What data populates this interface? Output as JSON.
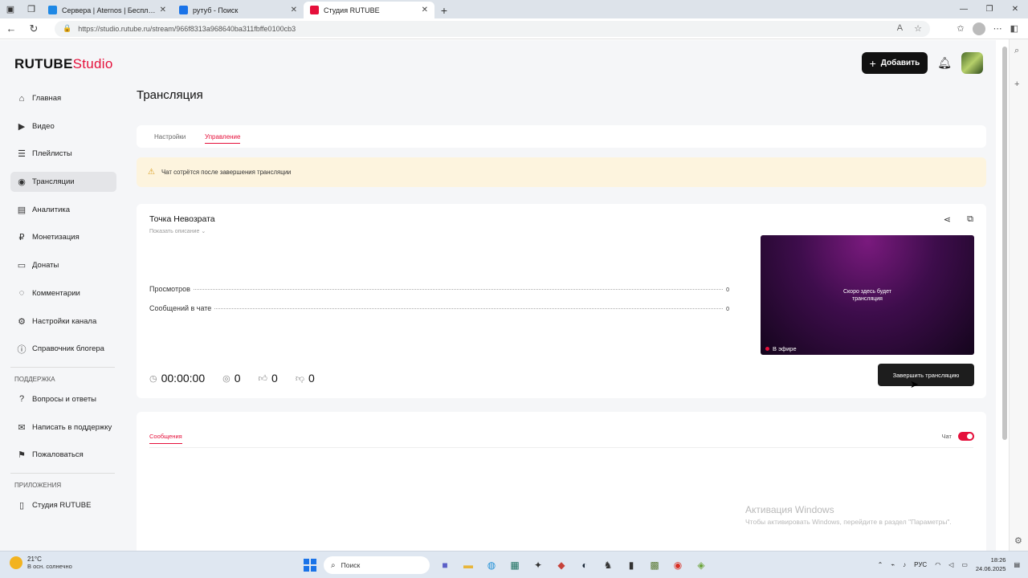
{
  "browser": {
    "tabs": [
      {
        "title": "Сервера | Aternos | Бесплатный",
        "active": false,
        "color": "#1e88e5"
      },
      {
        "title": "рутуб - Поиск",
        "active": false,
        "color": "#1a73e8"
      },
      {
        "title": "Студия RUTUBE",
        "active": true,
        "color": "#e5103b"
      }
    ],
    "url": "https://studio.rutube.ru/stream/966f8313a968640ba311fbffe0100cb3"
  },
  "app": {
    "logo_main": "RUTUBE",
    "logo_studio": "Studio",
    "add_button": "Добавить",
    "page_title": "Трансляция"
  },
  "sidebar": {
    "items": [
      {
        "label": "Главная",
        "icon": "home-icon"
      },
      {
        "label": "Видео",
        "icon": "video-icon"
      },
      {
        "label": "Плейлисты",
        "icon": "playlist-icon"
      },
      {
        "label": "Трансляции",
        "icon": "broadcast-icon"
      },
      {
        "label": "Аналитика",
        "icon": "analytics-icon"
      },
      {
        "label": "Монетизация",
        "icon": "money-icon"
      },
      {
        "label": "Донаты",
        "icon": "donate-icon"
      },
      {
        "label": "Комментарии",
        "icon": "comments-icon"
      },
      {
        "label": "Настройки канала",
        "icon": "settings-icon"
      },
      {
        "label": "Справочник блогера",
        "icon": "info-icon"
      }
    ],
    "support_title": "ПОДДЕРЖКА",
    "support_items": [
      {
        "label": "Вопросы и ответы"
      },
      {
        "label": "Написать в поддержку"
      },
      {
        "label": "Пожаловаться"
      }
    ],
    "apps_title": "ПРИЛОЖЕНИЯ",
    "apps_items": [
      {
        "label": "Студия RUTUBE"
      }
    ]
  },
  "tabs": {
    "settings": "Настройки",
    "manage": "Управление"
  },
  "warning": "Чат сотрётся после завершения трансляции",
  "stream": {
    "title": "Точка Невозрата",
    "show_description": "Показать описание",
    "stats": [
      {
        "label": "Просмотров",
        "value": "0"
      },
      {
        "label": "Сообщений в чате",
        "value": "0"
      }
    ],
    "duration": "00:00:00",
    "viewers": "0",
    "likes": "0",
    "dislikes": "0",
    "preview_text_1": "Скоро здесь будет",
    "preview_text_2": "трансляция",
    "live_label": "В эфире",
    "end_button": "Завершить трансляцию"
  },
  "chat": {
    "messages_tab": "Сообщения",
    "chat_label": "Чат",
    "chat_enabled": true
  },
  "watermark": {
    "title": "Активация Windows",
    "subtitle": "Чтобы активировать Windows, перейдите в раздел \"Параметры\"."
  },
  "taskbar": {
    "temperature": "21°C",
    "weather": "В осн. солнечно",
    "search": "Поиск",
    "lang": "РУС",
    "time": "18:26",
    "date": "24.06.2025"
  },
  "colors": {
    "accent": "#e5103b",
    "warning_bg": "#fdf4de"
  }
}
